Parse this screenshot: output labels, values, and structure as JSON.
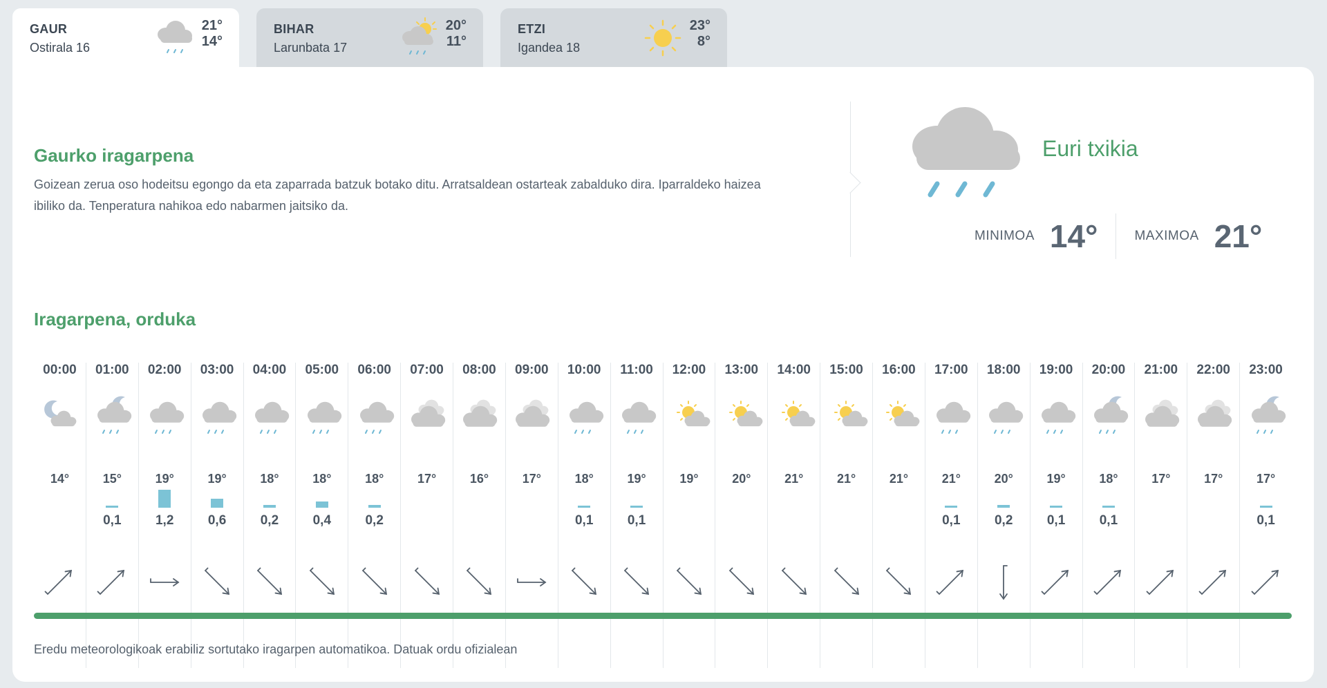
{
  "tabs": [
    {
      "name": "GAUR",
      "date": "Ostirala 16",
      "max": "21°",
      "min": "14°",
      "icon": "cloud-rain-icon",
      "active": true
    },
    {
      "name": "BIHAR",
      "date": "Larunbata 17",
      "max": "20°",
      "min": "11°",
      "icon": "sun-cloud-rain-icon",
      "active": false
    },
    {
      "name": "ETZI",
      "date": "Igandea 18",
      "max": "23°",
      "min": "8°",
      "icon": "sun-icon",
      "active": false
    }
  ],
  "today": {
    "title": "Gaurko iragarpena",
    "text": "Goizean zerua oso hodeitsu egongo da eta zaparrada batzuk botako ditu. Arratsaldean ostarteak zabalduko dira. Iparraldeko haizea ibiliko da. Tenperatura nahikoa edo nabarmen jaitsiko da.",
    "condition": "Euri txikia",
    "icon": "cloud-rain-icon",
    "min_label": "MINIMOA",
    "min_value": "14°",
    "max_label": "MAXIMOA",
    "max_value": "21°"
  },
  "hourly": {
    "title": "Iragarpena, orduka",
    "hours": [
      {
        "time": "00:00",
        "icon": "moon-cloud",
        "temp": "14°",
        "precip": "",
        "wind": "ne"
      },
      {
        "time": "01:00",
        "icon": "moon-cloud-rain",
        "temp": "15°",
        "precip": "0,1",
        "wind": "ne"
      },
      {
        "time": "02:00",
        "icon": "cloud-rain",
        "temp": "19°",
        "precip": "1,2",
        "wind": "e"
      },
      {
        "time": "03:00",
        "icon": "cloud-rain",
        "temp": "19°",
        "precip": "0,6",
        "wind": "se"
      },
      {
        "time": "04:00",
        "icon": "cloud-rain",
        "temp": "18°",
        "precip": "0,2",
        "wind": "se"
      },
      {
        "time": "05:00",
        "icon": "cloud-rain",
        "temp": "18°",
        "precip": "0,4",
        "wind": "se"
      },
      {
        "time": "06:00",
        "icon": "cloud-rain",
        "temp": "18°",
        "precip": "0,2",
        "wind": "se"
      },
      {
        "time": "07:00",
        "icon": "clouds",
        "temp": "17°",
        "precip": "",
        "wind": "se"
      },
      {
        "time": "08:00",
        "icon": "clouds",
        "temp": "16°",
        "precip": "",
        "wind": "se"
      },
      {
        "time": "09:00",
        "icon": "clouds",
        "temp": "17°",
        "precip": "",
        "wind": "e"
      },
      {
        "time": "10:00",
        "icon": "cloud-rain",
        "temp": "18°",
        "precip": "0,1",
        "wind": "se"
      },
      {
        "time": "11:00",
        "icon": "cloud-rain",
        "temp": "19°",
        "precip": "0,1",
        "wind": "se"
      },
      {
        "time": "12:00",
        "icon": "sun-cloud",
        "temp": "19°",
        "precip": "",
        "wind": "se"
      },
      {
        "time": "13:00",
        "icon": "sun-cloud",
        "temp": "20°",
        "precip": "",
        "wind": "se"
      },
      {
        "time": "14:00",
        "icon": "sun-cloud",
        "temp": "21°",
        "precip": "",
        "wind": "se"
      },
      {
        "time": "15:00",
        "icon": "sun-cloud",
        "temp": "21°",
        "precip": "",
        "wind": "se"
      },
      {
        "time": "16:00",
        "icon": "sun-cloud",
        "temp": "21°",
        "precip": "",
        "wind": "se"
      },
      {
        "time": "17:00",
        "icon": "cloud-rain",
        "temp": "21°",
        "precip": "0,1",
        "wind": "ne"
      },
      {
        "time": "18:00",
        "icon": "cloud-rain",
        "temp": "20°",
        "precip": "0,2",
        "wind": "s"
      },
      {
        "time": "19:00",
        "icon": "cloud-rain",
        "temp": "19°",
        "precip": "0,1",
        "wind": "ne"
      },
      {
        "time": "20:00",
        "icon": "moon-cloud-rain",
        "temp": "18°",
        "precip": "0,1",
        "wind": "ne"
      },
      {
        "time": "21:00",
        "icon": "clouds",
        "temp": "17°",
        "precip": "",
        "wind": "ne"
      },
      {
        "time": "22:00",
        "icon": "clouds",
        "temp": "17°",
        "precip": "",
        "wind": "ne"
      },
      {
        "time": "23:00",
        "icon": "moon-cloud-rain",
        "temp": "17°",
        "precip": "0,1",
        "wind": "ne"
      }
    ]
  },
  "footnote": "Eredu meteorologikoak erabiliz sortutako iragarpen automatikoa. Datuak ordu ofizialean",
  "colors": {
    "accent_green": "#4d9f6b",
    "rain_bar": "#7cc3d6",
    "cloud": "#c8c8c8",
    "sun": "#f7cf4f",
    "moon": "#b7c7d8",
    "rain_drop": "#6fb8d4"
  }
}
